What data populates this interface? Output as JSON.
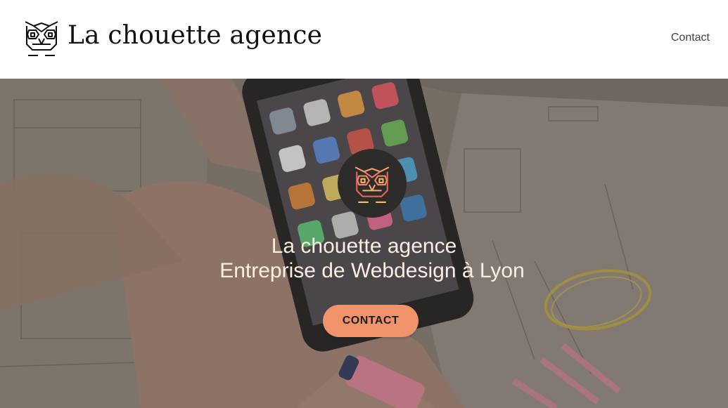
{
  "header": {
    "logo_icon": "owl-logo-icon",
    "brand": "La chouette agence",
    "nav_contact": "Contact"
  },
  "hero": {
    "badge_icon": "owl-logo-icon",
    "title": "La chouette agence",
    "subtitle": "Entreprise de Webdesign à Lyon",
    "cta_label": "CONTACT",
    "background": "photo-hand-holding-phone-over-sketches"
  },
  "colors": {
    "accent": "#f0936b",
    "header_bg": "#ffffff",
    "hero_text": "#fbeee2",
    "badge_bg": "#2e2c2b"
  }
}
